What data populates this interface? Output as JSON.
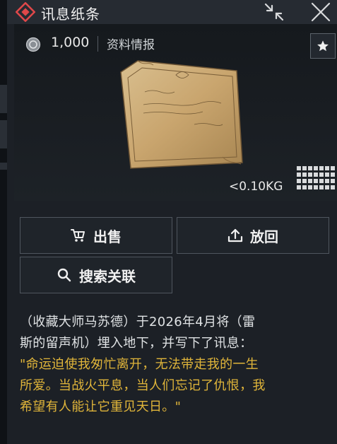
{
  "window": {
    "title": "讯息纸条"
  },
  "item": {
    "price": "1,000",
    "category": "资料情报",
    "weight": "<0.10KG",
    "image_name": "old-paper-note"
  },
  "actions": {
    "sell_label": "出售",
    "return_label": "放回",
    "search_label": "搜索关联"
  },
  "description": {
    "line1": "（收藏大师马苏德）于2026年4月将（雷",
    "line2": "斯的留声机）埋入地下，并写下了讯息：",
    "quote1": "\"命运迫使我匆忙离开，无法带走我的一生",
    "quote2": "所爱。当战火平息，当人们忘记了仇恨，我",
    "quote3": "希望有人能让它重见天日。\""
  },
  "colors": {
    "accent_red": "#e0484a",
    "quote_gold": "#e0b53a",
    "panel_bg": "#1c2026"
  },
  "icons": [
    "diamond-logo-icon",
    "collapse-icon",
    "close-icon",
    "coin-icon",
    "star-icon",
    "inventory-grid-icon",
    "cart-sell-icon",
    "upload-return-icon",
    "search-icon"
  ]
}
